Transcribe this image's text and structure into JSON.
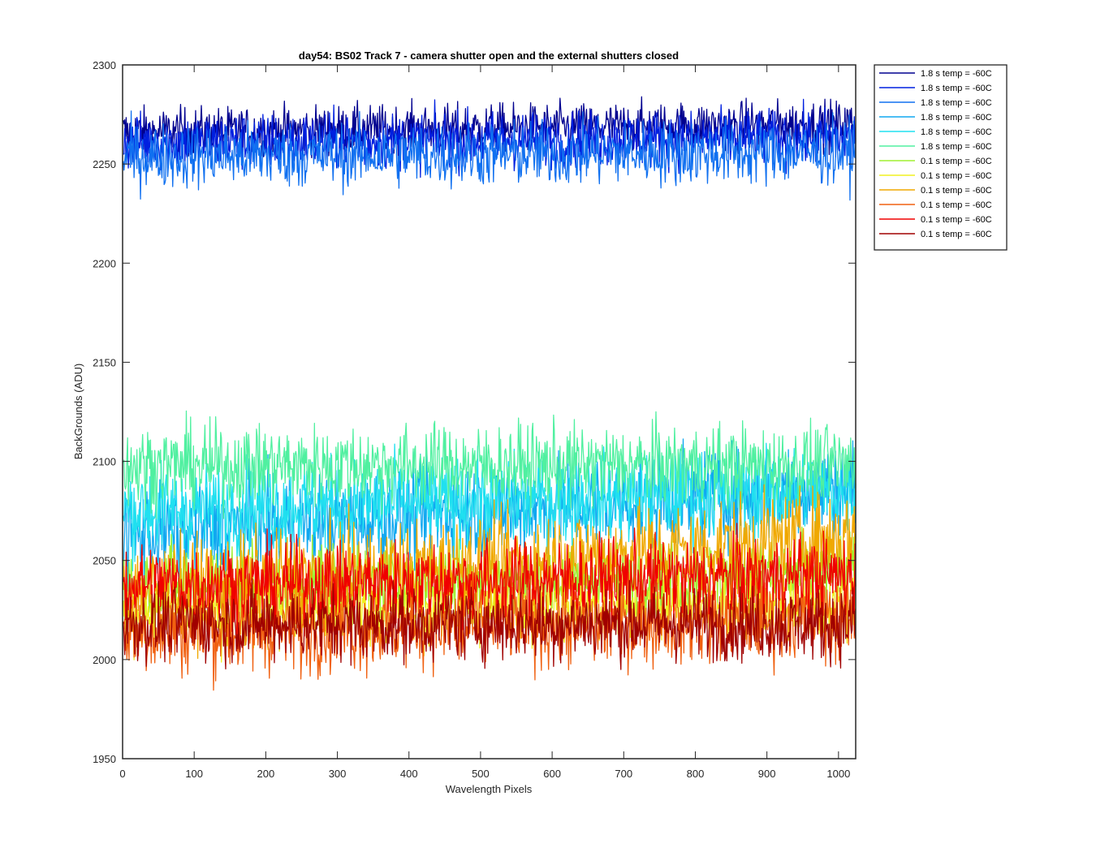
{
  "chart_data": {
    "type": "line",
    "title": "day54: BS02  Track 7 - camera shutter open and the external shutters closed",
    "xlabel": "Wavelength Pixels",
    "ylabel": "BackGrounds (ADU)",
    "xlim": [
      0,
      1024
    ],
    "ylim": [
      1950,
      2300
    ],
    "xticks": [
      "0",
      "100",
      "200",
      "300",
      "400",
      "500",
      "600",
      "700",
      "800",
      "900",
      "1000"
    ],
    "yticks": [
      "1950",
      "2000",
      "2050",
      "2100",
      "2150",
      "2200",
      "2250",
      "2300"
    ],
    "grid": false,
    "legend_position": "outside-top-right",
    "x_points": 1024,
    "series": [
      {
        "name": "1.8 s temp = -60C",
        "color": "#00008f",
        "mean": 2268,
        "trend": 4,
        "noise": 6
      },
      {
        "name": "1.8 s temp = -60C",
        "color": "#0020e0",
        "mean": 2262,
        "trend": 2,
        "noise": 7
      },
      {
        "name": "1.8 s temp = -60C",
        "color": "#1070f0",
        "mean": 2255,
        "trend": 2,
        "noise": 8
      },
      {
        "name": "1.8 s temp = -60C",
        "color": "#10a8f0",
        "mean": 2075,
        "trend": 25,
        "noise": 12
      },
      {
        "name": "1.8 s temp = -60C",
        "color": "#20e0f0",
        "mean": 2080,
        "trend": 10,
        "noise": 11
      },
      {
        "name": "1.8 s temp = -60C",
        "color": "#50f0a0",
        "mean": 2098,
        "trend": 0,
        "noise": 10
      },
      {
        "name": "0.1 s temp = -60C",
        "color": "#a0f030",
        "mean": 2040,
        "trend": 5,
        "noise": 10
      },
      {
        "name": "0.1 s temp = -60C",
        "color": "#f0f020",
        "mean": 2025,
        "trend": 5,
        "noise": 9
      },
      {
        "name": "0.1 s temp = -60C",
        "color": "#f0a800",
        "mean": 2048,
        "trend": 28,
        "noise": 12
      },
      {
        "name": "0.1 s temp = -60C",
        "color": "#f06010",
        "mean": 2018,
        "trend": 8,
        "noise": 11
      },
      {
        "name": "0.1 s temp = -60C",
        "color": "#f00000",
        "mean": 2040,
        "trend": 5,
        "noise": 10
      },
      {
        "name": "0.1 s temp = -60C",
        "color": "#a00000",
        "mean": 2018,
        "trend": 0,
        "noise": 9
      }
    ]
  }
}
